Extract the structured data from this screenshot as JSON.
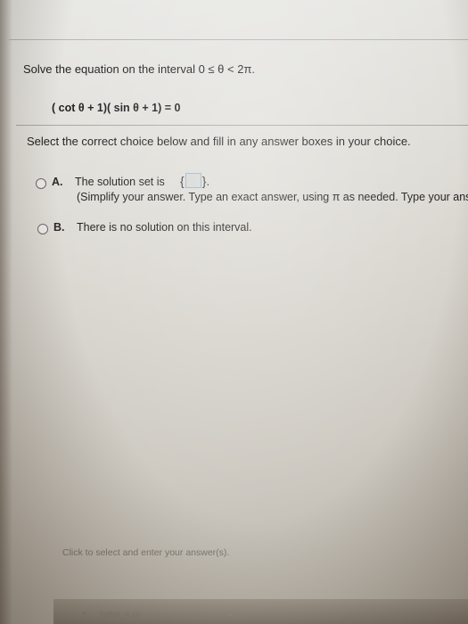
{
  "problem": {
    "prompt": "Solve the equation on the interval 0 ≤ θ < 2π.",
    "equation": "( cot θ + 1)( sin θ + 1) = 0"
  },
  "instruction": "Select the correct choice below and fill in any answer boxes in your choice.",
  "choices": [
    {
      "letter": "A.",
      "text_before_box": "The solution set is",
      "set_open": "{",
      "answer_value": "",
      "set_close": "}.",
      "hint": "(Simplify your answer. Type an exact answer, using π as needed. Type your answer in radians."
    },
    {
      "letter": "B.",
      "text": "There is no solution on this interval."
    }
  ],
  "footer_hint": "Click to select and enter your answer(s).",
  "download": {
    "icon": "download-indicator-icon",
    "file_name": "better_4.zip",
    "chevron": "chevron-up-icon"
  }
}
